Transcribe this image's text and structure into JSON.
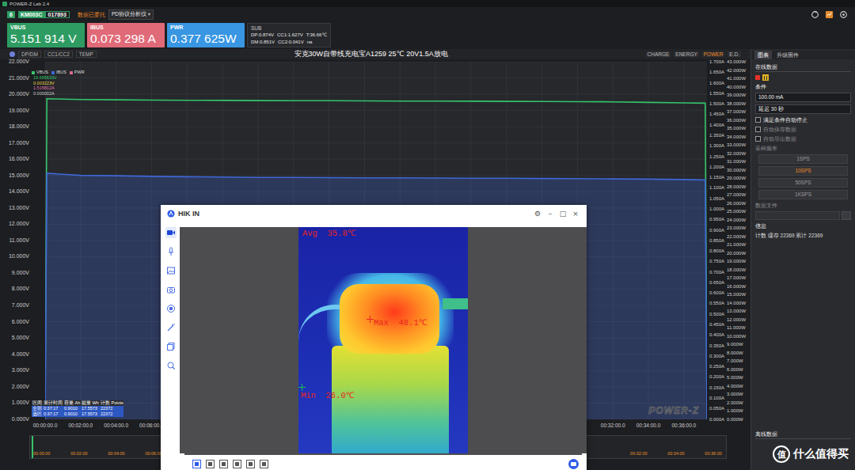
{
  "window": {
    "title": "POWER-Z Lab 2.4"
  },
  "device_bar": {
    "port": "6",
    "model": "KM003C",
    "serial": "017893",
    "status": "数据已委托",
    "mode": "PD协议分析仪",
    "mode_arrow": "▾"
  },
  "readings": [
    {
      "label": "VBUS",
      "value": "5.151 914 V",
      "color": "#2e9c62"
    },
    {
      "label": "IBUS",
      "value": "0.073 298 A",
      "color": "#e06a78"
    },
    {
      "label": "PWR",
      "value": "0.377 625W",
      "color": "#3896e2"
    }
  ],
  "sub": {
    "label": "SUB",
    "rows": [
      [
        "DP:0.874V",
        "CC1:1.627V",
        "T:36.66℃"
      ],
      [
        "DM:0.851V",
        "CC2:0.041V",
        "na"
      ]
    ]
  },
  "chart": {
    "left_tabs": [
      {
        "label": "DP/DM",
        "selected": false
      },
      {
        "label": "CC1/CC2",
        "selected": false
      },
      {
        "label": "TEMP",
        "selected": false
      }
    ],
    "title": "安克30W自带线充电宝A1259 25℃ 20V1.5A放电",
    "right_tabs": [
      {
        "label": "CHARGE",
        "selected": false
      },
      {
        "label": "ENERGY",
        "selected": false
      },
      {
        "label": "POWER",
        "selected": true
      },
      {
        "label": "E.D.",
        "selected": false
      }
    ],
    "legend": [
      {
        "label": "VBUS",
        "color": "#35c46a"
      },
      {
        "label": "IBUS",
        "color": "#3f67d6"
      },
      {
        "label": "PWR",
        "color": "#d96a8a"
      }
    ],
    "cursor_values": [
      {
        "text": "19.695633V",
        "color": "#35c46a"
      },
      {
        "text": "0.003223V",
        "color": "#e8d24a"
      },
      {
        "text": "1.515812A",
        "color": "#e07ab0"
      },
      {
        "text": "0.000002A",
        "color": "#cfcfcf"
      }
    ],
    "v_axis": {
      "max": 22,
      "labels": [
        "22.000V",
        "21.000V",
        "20.000V",
        "19.000V",
        "18.000V",
        "17.000V",
        "16.000V",
        "15.000V",
        "14.000V",
        "13.000V",
        "12.000V",
        "11.000V",
        "10.000V",
        "9.000V",
        "8.000V",
        "7.000V",
        "6.000V",
        "5.000V",
        "4.000V",
        "3.000V",
        "2.000V",
        "1.000V",
        "0.000V"
      ]
    },
    "a_axis": {
      "max": 1.7,
      "labels": [
        "1.700A",
        "1.650A",
        "1.600A",
        "1.550A",
        "1.500A",
        "1.450A",
        "1.400A",
        "1.350A",
        "1.300A",
        "1.250A",
        "1.200A",
        "1.150A",
        "1.100A",
        "1.050A",
        "1.000A",
        "0.950A",
        "0.900A",
        "0.850A",
        "0.800A",
        "0.750A",
        "0.700A",
        "0.650A",
        "0.600A",
        "0.550A",
        "0.500A",
        "0.450A",
        "0.400A",
        "0.350A",
        "0.300A",
        "0.250A",
        "0.200A",
        "0.150A",
        "0.100A",
        "0.050A",
        "0.000A"
      ]
    },
    "w_axis": {
      "max": 43,
      "labels": [
        "43.000W",
        "42.000W",
        "41.000W",
        "40.000W",
        "39.000W",
        "38.000W",
        "37.000W",
        "36.000W",
        "35.000W",
        "34.000W",
        "33.000W",
        "32.000W",
        "31.000W",
        "30.000W",
        "29.000W",
        "28.000W",
        "27.000W",
        "26.000W",
        "25.000W",
        "24.000W",
        "23.000W",
        "22.000W",
        "21.000W",
        "20.000W",
        "19.000W",
        "18.000W",
        "17.000W",
        "16.000W",
        "15.000W",
        "14.000W",
        "13.000W",
        "12.000W",
        "11.000W",
        "10.000W",
        "9.000W",
        "8.000W",
        "7.000W",
        "6.000W",
        "5.000W",
        "4.000W",
        "3.000W",
        "2.000W",
        "1.000W",
        "0.000W"
      ]
    },
    "x_axis": {
      "max_min": 37.3,
      "grid_step_min": 2,
      "ticks": [
        {
          "label": "00:00:00.0",
          "min": 0
        },
        {
          "label": "00:02:00.0",
          "min": 2
        },
        {
          "label": "00:04:00.0",
          "min": 4
        },
        {
          "label": "00:06:00.0",
          "min": 6
        },
        {
          "label": "00:32:00.0",
          "min": 32
        },
        {
          "label": "00:34:00.0",
          "min": 34
        },
        {
          "label": "00:36:00.0",
          "min": 36
        }
      ]
    },
    "time_min": [
      0,
      0.1,
      1,
      2,
      4,
      6,
      8,
      10,
      12,
      14,
      16,
      18,
      20,
      22,
      24,
      26,
      28,
      30,
      32,
      34,
      36,
      37.2,
      37.3
    ],
    "series": [
      {
        "name": "VBUS",
        "axis": "v",
        "color": "#35c46a",
        "fill": false,
        "values": [
          0,
          19.72,
          19.7,
          19.68,
          19.66,
          19.64,
          19.63,
          19.62,
          19.61,
          19.6,
          19.6,
          19.59,
          19.58,
          19.58,
          19.57,
          19.56,
          19.55,
          19.54,
          19.53,
          19.5,
          19.47,
          19.45,
          0
        ]
      },
      {
        "name": "IBUS",
        "axis": "a",
        "color": "#3f67d6",
        "fill": true,
        "values": [
          0,
          1.17,
          1.165,
          1.16,
          1.158,
          1.155,
          1.153,
          1.152,
          1.15,
          1.15,
          1.149,
          1.148,
          1.148,
          1.147,
          1.146,
          1.146,
          1.145,
          1.144,
          1.143,
          1.142,
          1.14,
          1.138,
          0
        ]
      }
    ],
    "stats": {
      "columns": [
        "区间",
        "累计时间",
        "容量 Ah",
        "能量 Wh",
        "计数 Points"
      ],
      "rows": [
        [
          "全部",
          "0:37:17",
          "0.9010",
          "17.5573",
          "22372"
        ],
        [
          "选区",
          "0:37:17",
          "0.9010",
          "17.5573",
          "22372"
        ]
      ]
    },
    "watermark": "POWER-Z",
    "overview_ticks": [
      {
        "label": "00:00:00",
        "min": 0
      },
      {
        "label": "00:02:00",
        "min": 2
      },
      {
        "label": "00:04:00",
        "min": 4
      },
      {
        "label": "00:06:00",
        "min": 6
      },
      {
        "label": "00:32:00",
        "min": 32
      },
      {
        "label": "00:34:00",
        "min": 34
      },
      {
        "label": "00:36:00",
        "min": 36
      }
    ]
  },
  "side_panel": {
    "tabs": [
      {
        "label": "图表",
        "selected": true
      },
      {
        "label": "升级固件",
        "selected": false
      }
    ],
    "section": "在线数据",
    "buttons": [
      {
        "kind": "stop"
      },
      {
        "kind": "pause"
      }
    ],
    "condition_label": "条件",
    "fields": [
      "100.00 mA",
      "延迟 30 秒"
    ],
    "checks": [
      {
        "label": "满足条件自动停止",
        "checked": false,
        "disabled": false
      },
      {
        "label": "自动保存数据",
        "checked": false,
        "disabled": true
      },
      {
        "label": "自动导出数据",
        "checked": false,
        "disabled": true
      }
    ],
    "rate_label": "采样频率",
    "rates": [
      {
        "label": "1SPS",
        "selected": false
      },
      {
        "label": "10SPS",
        "selected": true
      },
      {
        "label": "50SPS",
        "selected": false
      },
      {
        "label": "1KSPS",
        "selected": false
      }
    ],
    "file_label": "数据文件",
    "info_label": "信息",
    "info_text": "计数 缓存 22369 累计 22369",
    "offline": "离线数据"
  },
  "popup": {
    "logo": "HIK IN",
    "controls": [
      "⚙",
      "–",
      "□",
      "×"
    ],
    "tools": [
      {
        "kind": "video",
        "selected": true
      },
      {
        "kind": "mic",
        "selected": false
      },
      {
        "kind": "image",
        "selected": false
      },
      {
        "kind": "camera",
        "selected": false
      },
      {
        "kind": "ai",
        "selected": false
      },
      {
        "kind": "wand",
        "selected": false
      },
      {
        "kind": "layers",
        "selected": false
      },
      {
        "kind": "search",
        "selected": false
      }
    ],
    "readouts": [
      {
        "kind": "avg",
        "label": "Avg",
        "value": "35.8℃",
        "color": "#e8251d"
      },
      {
        "kind": "max",
        "label": "Max",
        "value": "48.1℃",
        "color": "#e8251d"
      },
      {
        "kind": "min",
        "label": "Min",
        "value": "26.0℃",
        "color": "#19c24a"
      }
    ],
    "bottom_tools": [
      {
        "selected": true
      },
      {
        "selected": false
      },
      {
        "selected": false
      },
      {
        "selected": false
      },
      {
        "selected": false
      },
      {
        "selected": false
      }
    ]
  },
  "watermark": {
    "badge": "值",
    "text": "什么值得买"
  }
}
